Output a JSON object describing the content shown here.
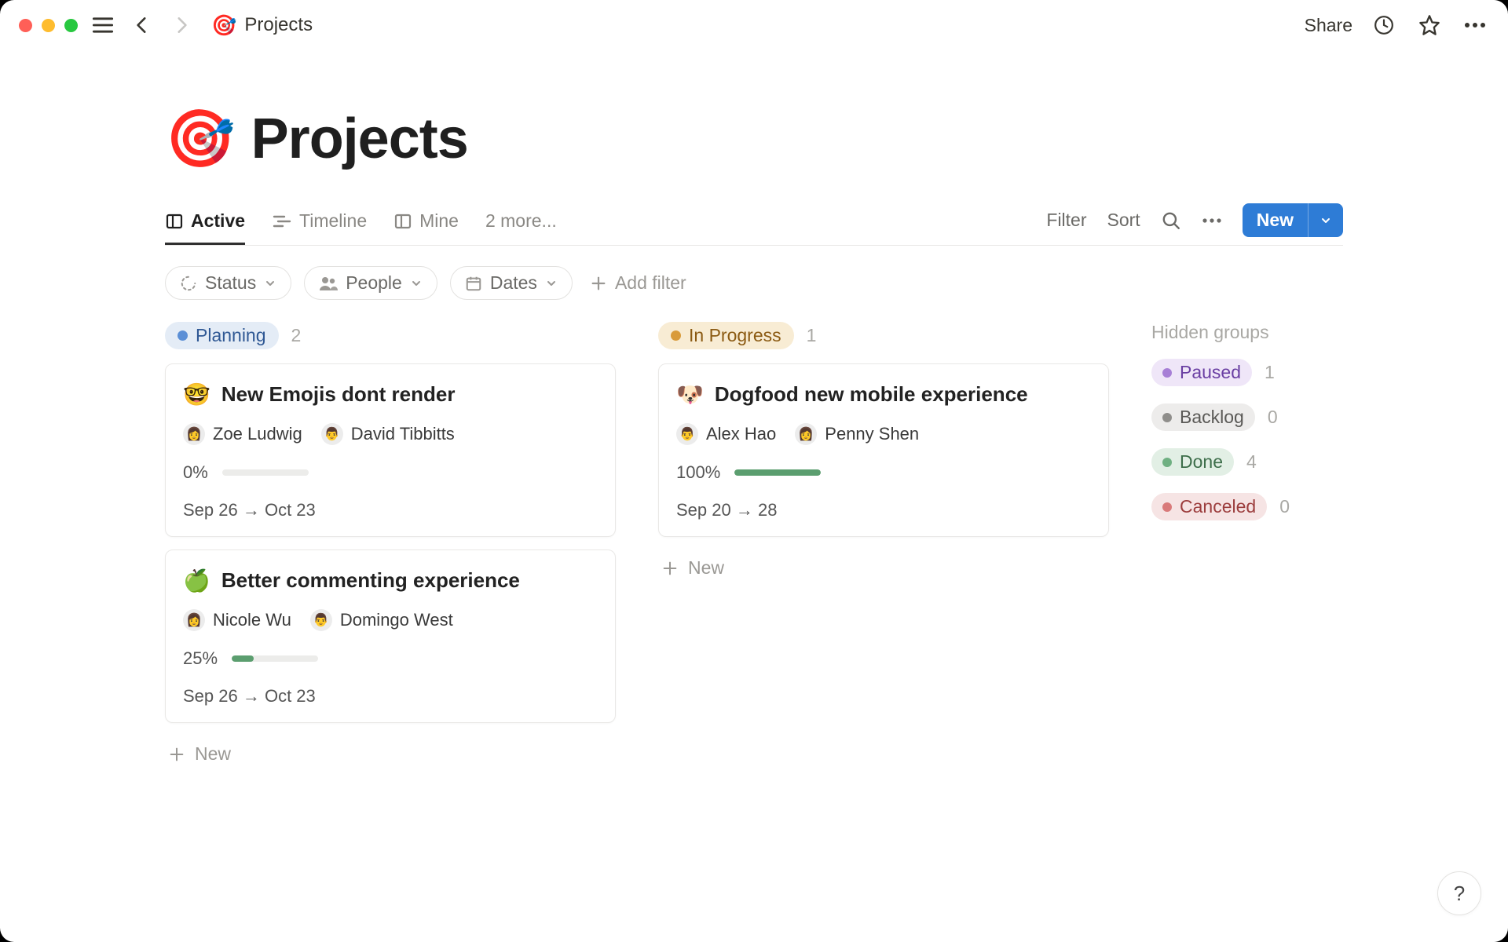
{
  "header": {
    "page_emoji": "🎯",
    "page_title": "Projects",
    "share_label": "Share"
  },
  "title": {
    "emoji": "🎯",
    "text": "Projects"
  },
  "views": {
    "tabs": [
      {
        "label": "Active",
        "icon": "board-icon",
        "active": true
      },
      {
        "label": "Timeline",
        "icon": "timeline-icon",
        "active": false
      },
      {
        "label": "Mine",
        "icon": "board-icon",
        "active": false
      }
    ],
    "more_label": "2 more...",
    "filter_label": "Filter",
    "sort_label": "Sort",
    "new_label": "New"
  },
  "filters": {
    "chips": [
      {
        "label": "Status",
        "icon": "status-icon"
      },
      {
        "label": "People",
        "icon": "people-icon"
      },
      {
        "label": "Dates",
        "icon": "calendar-icon"
      }
    ],
    "add_label": "Add filter"
  },
  "board": {
    "columns": [
      {
        "status": {
          "label": "Planning",
          "bullet_color": "#5b8fd6",
          "bg": "#e4ecf6",
          "fg": "#2f5894"
        },
        "count": "2",
        "cards": [
          {
            "emoji": "🤓",
            "title": "New Emojis dont  render",
            "assignees": [
              {
                "avatar": "👩",
                "name": "Zoe Ludwig"
              },
              {
                "avatar": "👨",
                "name": "David Tibbitts"
              }
            ],
            "progress_pct": "0%",
            "progress_val": 0,
            "date_range": "Sep 26 → Oct 23"
          },
          {
            "emoji": "🍏",
            "title": "Better commenting experience",
            "assignees": [
              {
                "avatar": "👩",
                "name": "Nicole Wu"
              },
              {
                "avatar": "👨",
                "name": "Domingo West"
              }
            ],
            "progress_pct": "25%",
            "progress_val": 25,
            "date_range": "Sep 26 → Oct 23"
          }
        ]
      },
      {
        "status": {
          "label": "In Progress",
          "bullet_color": "#d99b3b",
          "bg": "#f8ecd4",
          "fg": "#8b5a12"
        },
        "count": "1",
        "cards": [
          {
            "emoji": "🐶",
            "title": "Dogfood new mobile experience",
            "assignees": [
              {
                "avatar": "👨",
                "name": "Alex Hao"
              },
              {
                "avatar": "👩",
                "name": "Penny Shen"
              }
            ],
            "progress_pct": "100%",
            "progress_val": 100,
            "date_range": "Sep 20 → 28"
          }
        ]
      }
    ],
    "new_label": "New"
  },
  "hidden": {
    "title": "Hidden groups",
    "groups": [
      {
        "label": "Paused",
        "bullet_color": "#a77fd6",
        "bg": "#efe6f8",
        "fg": "#6a3fa3",
        "count": "1"
      },
      {
        "label": "Backlog",
        "bullet_color": "#8f8e8b",
        "bg": "#edeceb",
        "fg": "#5a5956",
        "count": "0"
      },
      {
        "label": "Done",
        "bullet_color": "#6fb082",
        "bg": "#e2efe5",
        "fg": "#3d6e4a",
        "count": "4"
      },
      {
        "label": "Canceled",
        "bullet_color": "#d97a7a",
        "bg": "#f6e4e4",
        "fg": "#9c3d3d",
        "count": "0"
      }
    ]
  },
  "help_label": "?"
}
